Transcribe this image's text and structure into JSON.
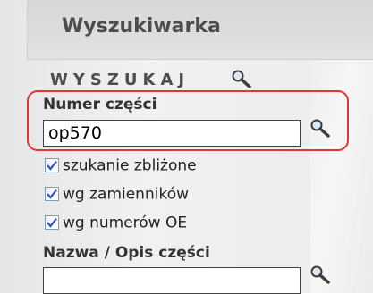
{
  "header": {
    "title": "Wyszukiwarka"
  },
  "search": {
    "section_title": "WYSZUKAJ",
    "part_number": {
      "label": "Numer części",
      "value": "op570"
    },
    "options": [
      {
        "label": "szukanie zbliżone",
        "checked": true
      },
      {
        "label": "wg zamienników",
        "checked": true
      },
      {
        "label": "wg numerów OE",
        "checked": true
      }
    ],
    "part_name": {
      "label": "Nazwa / Opis części",
      "value": ""
    }
  },
  "colors": {
    "highlight": "#e43535",
    "check": "#2b55b8"
  },
  "icons": {
    "search": "magnifier-icon",
    "checkbox_mark": "checkmark-icon"
  }
}
